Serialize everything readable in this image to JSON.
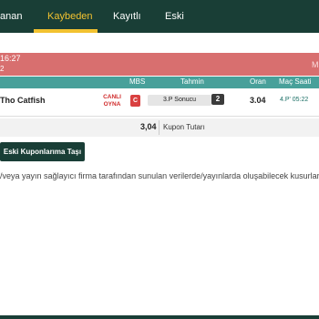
{
  "nav": {
    "tabs": [
      {
        "label": "anan"
      },
      {
        "label": "Kaybeden"
      },
      {
        "label": "Kayıtlı"
      },
      {
        "label": "Eski"
      }
    ],
    "active_tab": "Kaybeden"
  },
  "alert": {
    "line1": "16:27",
    "line2": "2",
    "right": "M"
  },
  "table": {
    "headers": [
      "MBS",
      "Tahmin",
      "Oran",
      "Maç Saati"
    ],
    "row": {
      "team": "Tho Catfish",
      "live_badge": "CANLI OYNA",
      "mbs": "C",
      "prediction": "3.P Sonucu",
      "pick": "2",
      "odds": "3.04",
      "match_time": "4.P' 05:22"
    }
  },
  "summary": {
    "total": "3,04",
    "label": "Kupon Tutarı"
  },
  "actions": {
    "move_button": "Eski Kuponlarıma Taşı"
  },
  "disclaimer": "/veya yayın sağlayıcı firma tarafından sunulan verilerde/yayınlarda oluşabilecek kusurlardan",
  "colors": {
    "nav_bg": "#193e36",
    "accent": "#f2c230",
    "header_teal": "#48a09a",
    "alert_red": "#d86f6f",
    "mbs_red": "#d94040"
  }
}
